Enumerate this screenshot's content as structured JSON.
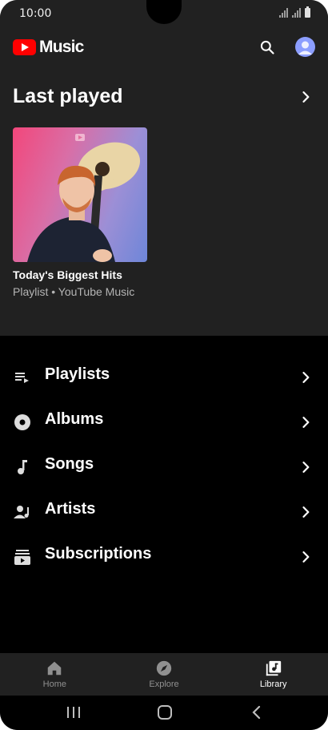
{
  "status_bar": {
    "time": "10:00"
  },
  "app": {
    "logo_text": "Music",
    "brand_color": "#ff0000"
  },
  "topbar": {
    "search_icon": "search-icon",
    "account_icon": "account-avatar"
  },
  "recent": {
    "title": "Last played",
    "card": {
      "title": "Today's Biggest Hits",
      "subtitle": "Playlist • YouTube Music"
    }
  },
  "library": {
    "items": [
      {
        "label": "Playlists",
        "icon": "playlist-icon"
      },
      {
        "label": "Albums",
        "icon": "album-icon"
      },
      {
        "label": "Songs",
        "icon": "music-note-icon"
      },
      {
        "label": "Artists",
        "icon": "artist-icon"
      },
      {
        "label": "Subscriptions",
        "icon": "subscriptions-icon"
      }
    ]
  },
  "bottom_nav": {
    "items": [
      {
        "label": "Home",
        "icon": "home-icon",
        "active": false
      },
      {
        "label": "Explore",
        "icon": "compass-icon",
        "active": false
      },
      {
        "label": "Library",
        "icon": "library-icon",
        "active": true
      }
    ]
  },
  "colors": {
    "surface": "#212121",
    "background": "#000000",
    "text": "#ffffff",
    "secondary_text": "#b5b5b5"
  }
}
